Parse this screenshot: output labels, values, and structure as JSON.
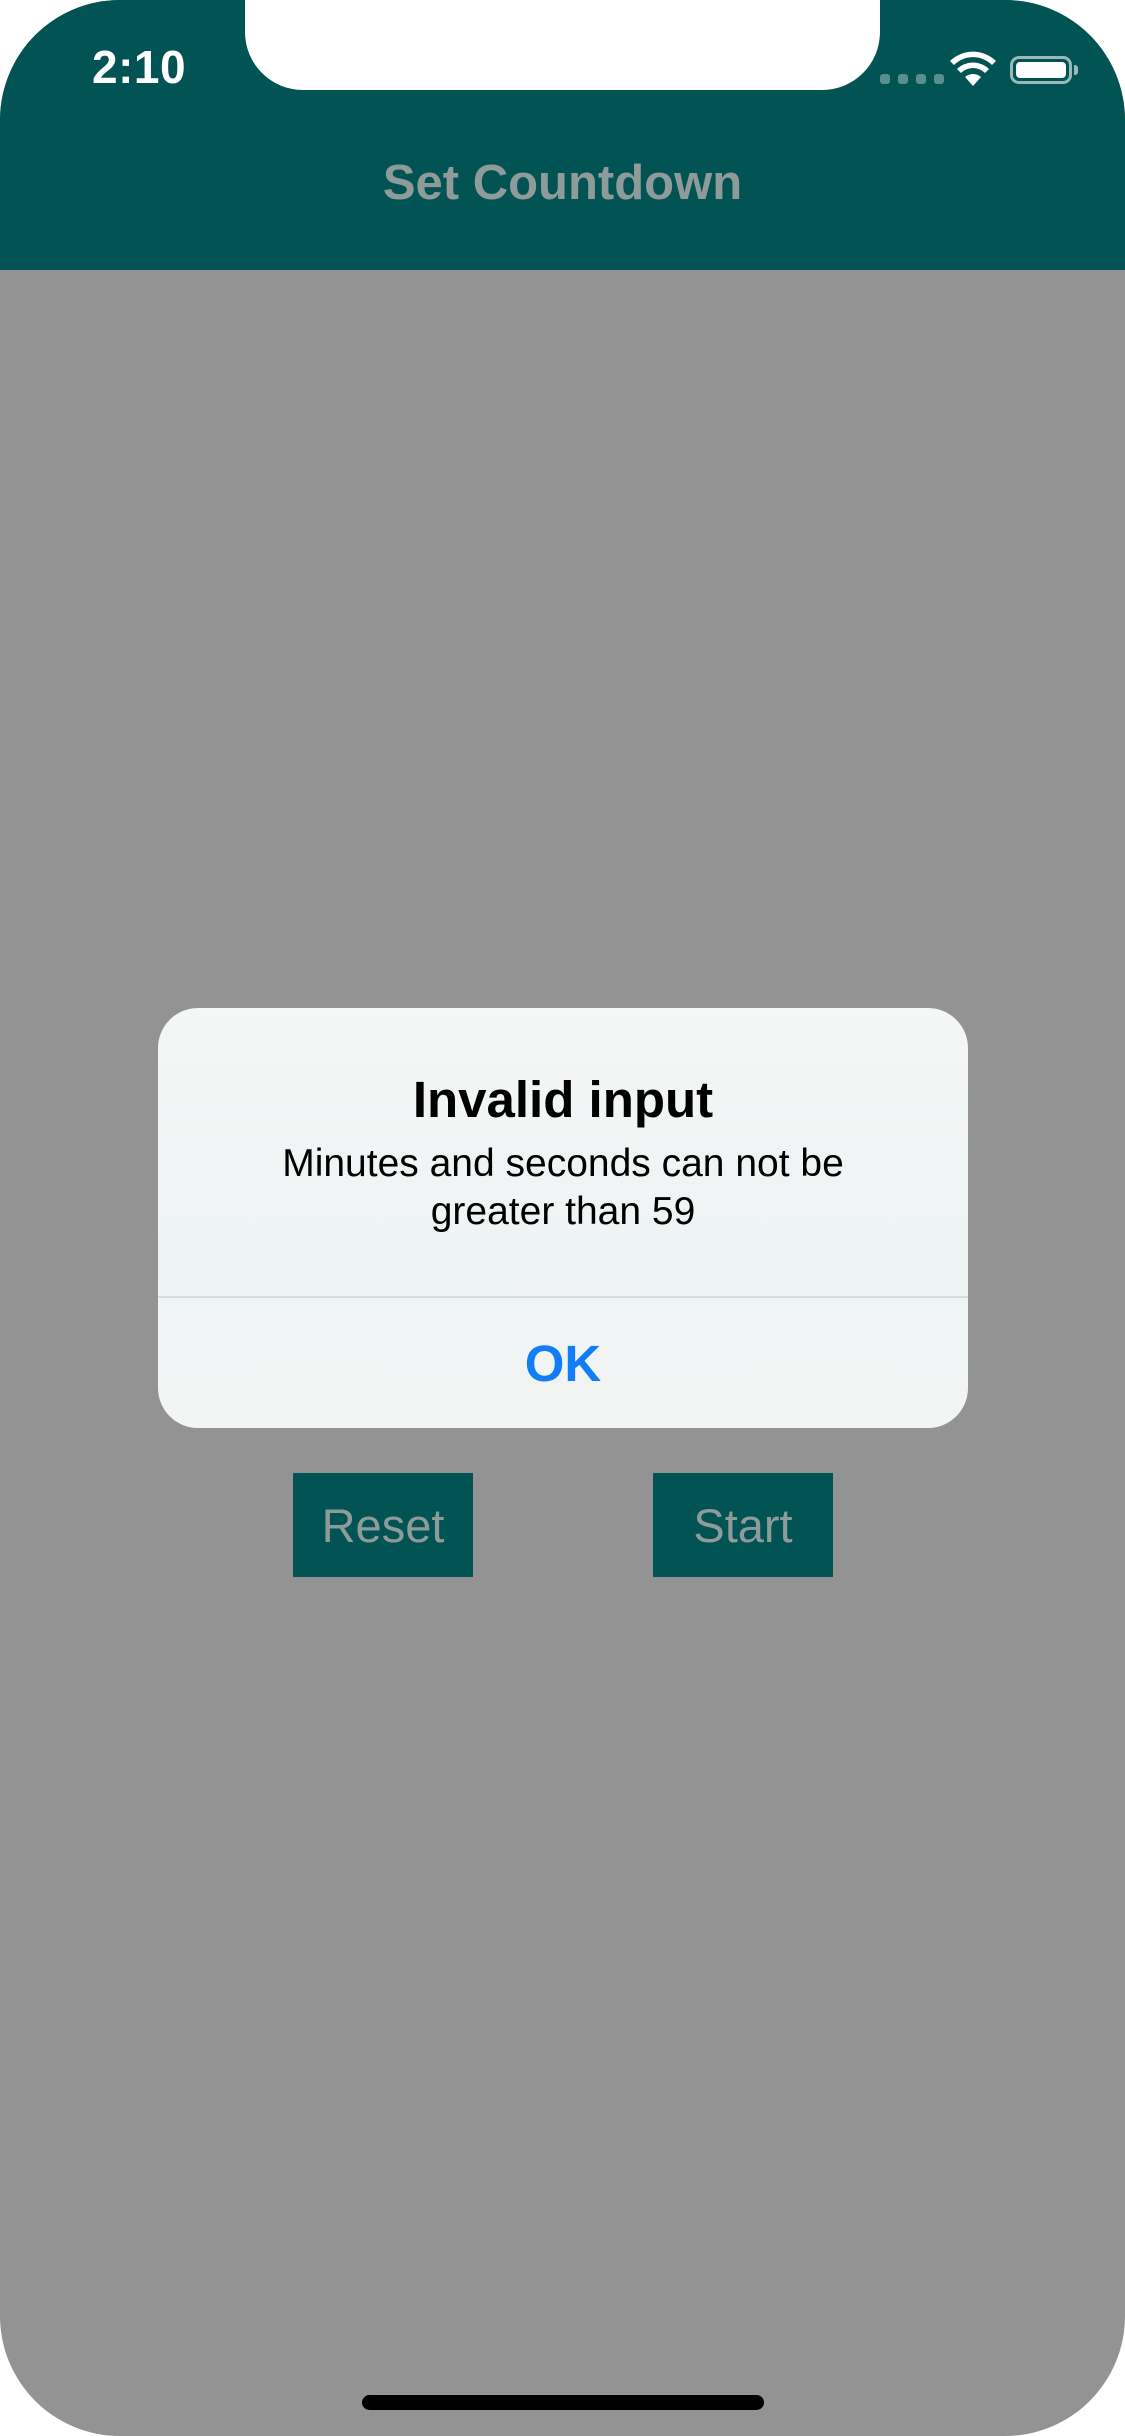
{
  "status_bar": {
    "time": "2:10"
  },
  "navbar": {
    "title": "Set Countdown"
  },
  "buttons": {
    "reset_label": "Reset",
    "start_label": "Start"
  },
  "alert": {
    "title": "Invalid input",
    "message": "Minutes and seconds can not be greater than 59",
    "ok_label": "OK"
  },
  "colors": {
    "nav_background": "#025353",
    "overlay_dim": "#939393",
    "alert_button_text": "#117ef5",
    "button_background": "#025353"
  },
  "icons": [
    "signal-icon",
    "wifi-icon",
    "battery-icon"
  ]
}
